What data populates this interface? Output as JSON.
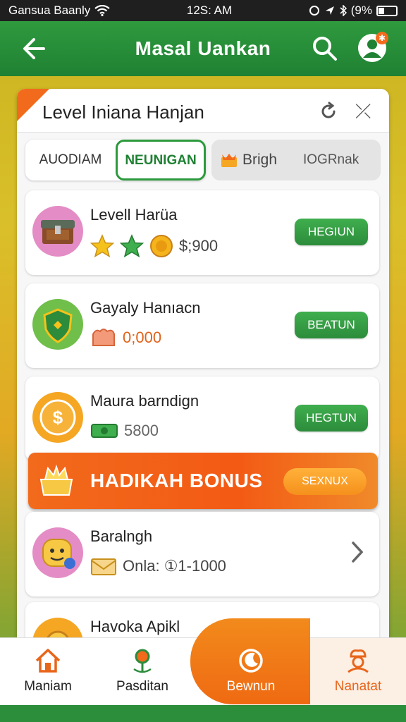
{
  "status_bar": {
    "carrier": "Gansua Baanly",
    "time": "12S: AM",
    "battery": "(9%"
  },
  "app_bar": {
    "title": "Masal Uankan"
  },
  "card": {
    "title": "Level Iniana Hanjan"
  },
  "tabs": [
    {
      "label": "AUODIAM"
    },
    {
      "label": "NEUNIGAN"
    },
    {
      "label": "Brigh"
    },
    {
      "label": "IOGRnak"
    }
  ],
  "rows": [
    {
      "title": "Levell Harüa",
      "sub": "$;900",
      "button": "HEGIUN"
    },
    {
      "title": "Gayaly Hanıacn",
      "sub": "0;000",
      "button": "BEATUN"
    },
    {
      "title": "Maura barndign",
      "sub": "5800",
      "button": "HEGTUN"
    },
    {
      "title": "Baralngh",
      "sub": "Onla: ①1-1000"
    },
    {
      "title": "Havoka Apikl"
    }
  ],
  "bonus": {
    "title": "HADIKAH BONUS",
    "button": "SEXNUX"
  },
  "bottom_nav": [
    {
      "label": "Maniam",
      "icon": "house-icon"
    },
    {
      "label": "Pasditan",
      "icon": "map-pin-icon"
    },
    {
      "label": "Bewnun",
      "icon": "moon-icon"
    },
    {
      "label": "Nanatat",
      "icon": "chef-icon"
    }
  ],
  "colors": {
    "primary_green": "#2c9a3c",
    "accent_orange": "#f26a1c"
  }
}
